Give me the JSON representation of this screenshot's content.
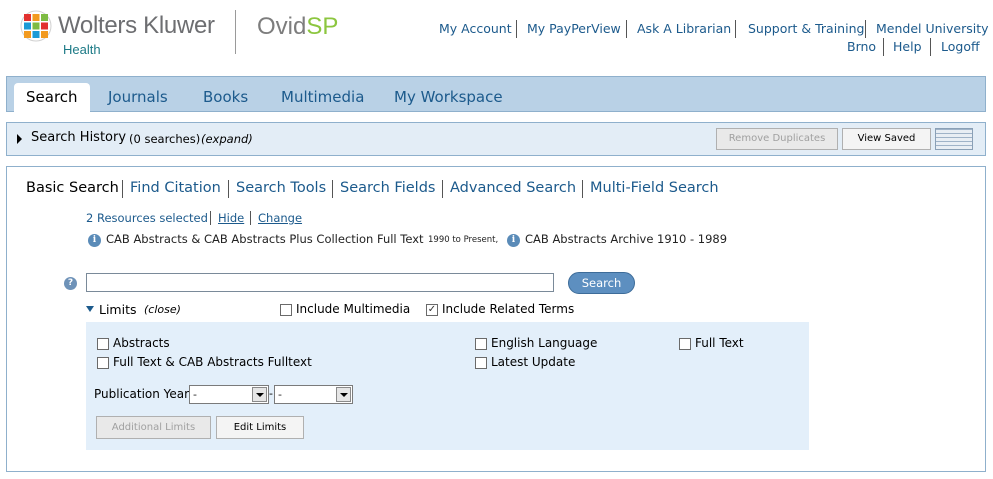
{
  "header": {
    "brand_name": "Wolters Kluwer",
    "brand_sub": "Health",
    "product_part1": "Ovid",
    "product_part2": "SP",
    "links": {
      "my_account": "My Account",
      "my_payperview": "My PayPerView",
      "ask_librarian": "Ask A Librarian",
      "support_training": "Support & Training",
      "institution_line1": "Mendel University in",
      "institution_line2": "Brno",
      "help": "Help",
      "logoff": "Logoff"
    }
  },
  "tabs": {
    "search": "Search",
    "journals": "Journals",
    "books": "Books",
    "multimedia": "Multimedia",
    "my_workspace": "My Workspace"
  },
  "history": {
    "title": "Search History",
    "count": "(0 searches)",
    "expand": "(expand)",
    "remove_duplicates": "Remove Duplicates",
    "view_saved": "View Saved"
  },
  "subnav": {
    "basic_search": "Basic Search",
    "find_citation": "Find Citation",
    "search_tools": "Search Tools",
    "search_fields": "Search Fields",
    "advanced_search": "Advanced Search",
    "multi_field_search": "Multi-Field Search"
  },
  "resources": {
    "selected": "2 Resources selected",
    "hide": "Hide",
    "change": "Change",
    "res1_name": "CAB Abstracts & CAB Abstracts Plus Collection Full Text",
    "res1_range": "1990 to Present,",
    "res2_name": "CAB Abstracts Archive 1910 - 1989"
  },
  "search": {
    "value": "",
    "button": "Search"
  },
  "limits": {
    "title": "Limits",
    "close": "(close)",
    "include_multimedia": "Include Multimedia",
    "include_multimedia_checked": false,
    "include_related_terms": "Include Related Terms",
    "include_related_terms_checked": true,
    "abstracts": "Abstracts",
    "english_language": "English Language",
    "full_text": "Full Text",
    "full_text_cab": "Full Text & CAB Abstracts Fulltext",
    "latest_update": "Latest Update",
    "publication_year": "Publication Year",
    "year_from": "-",
    "year_sep": "-",
    "year_to": "-",
    "additional_limits": "Additional Limits",
    "edit_limits": "Edit Limits"
  },
  "colors": {
    "link": "#1c5a8c",
    "tabbar": "#b9d1e6",
    "limits_bg": "#e3effa",
    "search_button": "#5d8fc0",
    "ovid_green": "#8cc63f"
  }
}
